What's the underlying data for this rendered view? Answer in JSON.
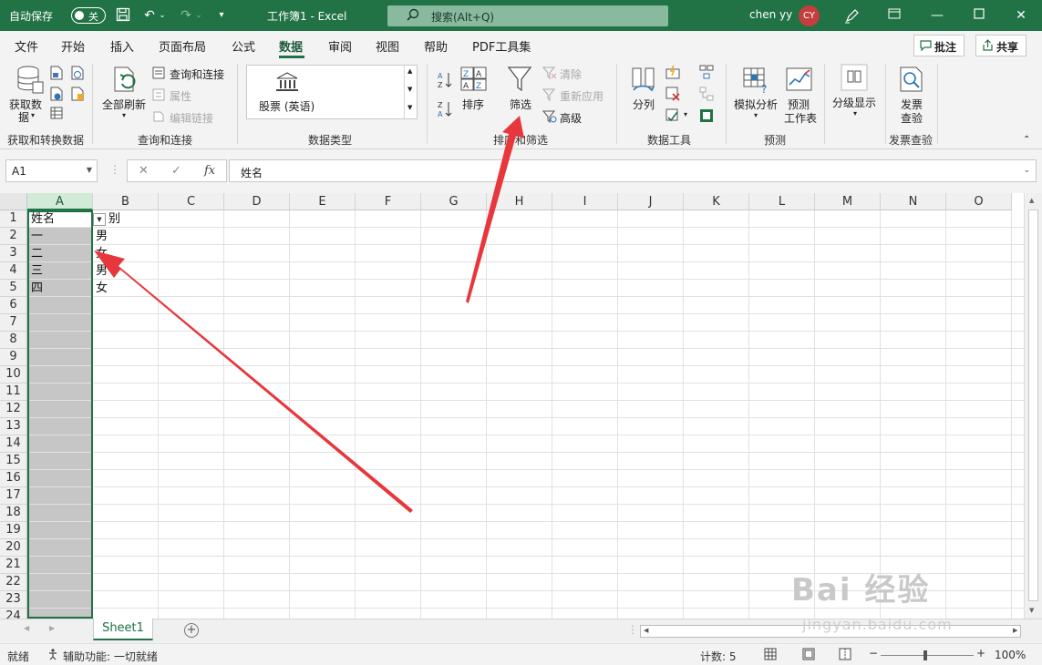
{
  "titlebar": {
    "autosave_label": "自动保存",
    "autosave_state": "关",
    "doc_title": "工作簿1  -  Excel",
    "search_placeholder": "搜索(Alt+Q)",
    "user_name": "chen yy",
    "user_initials": "CY"
  },
  "menu": {
    "tabs": [
      "文件",
      "开始",
      "插入",
      "页面布局",
      "公式",
      "数据",
      "审阅",
      "视图",
      "帮助",
      "PDF工具集"
    ],
    "active_tab": "数据",
    "comments_label": "批注",
    "share_label": "共享"
  },
  "ribbon": {
    "get_data": "获取数",
    "get_data2": "据",
    "refresh_all": "全部刷新",
    "queries_connections": "查询和连接",
    "properties": "属性",
    "edit_links": "编辑链接",
    "stocks": "股票 (英语)",
    "sort": "排序",
    "filter": "筛选",
    "clear": "清除",
    "reapply": "重新应用",
    "advanced": "高级",
    "text_to_columns": "分列",
    "what_if": "模拟分析",
    "forecast_sheet": "预测",
    "forecast_sheet2": "工作表",
    "outline": "分级显示",
    "invoice_check": "发票",
    "invoice_check2": "查验",
    "groups": {
      "get_transform": "获取和转换数据",
      "queries": "查询和连接",
      "data_types": "数据类型",
      "sort_filter": "排序和筛选",
      "data_tools": "数据工具",
      "forecast": "预测",
      "invoice": "发票查验"
    }
  },
  "formula_bar": {
    "name_box": "A1",
    "cancel": "✕",
    "enter": "✓",
    "fx": "fx",
    "content": "姓名"
  },
  "sheet": {
    "columns": [
      "A",
      "B",
      "C",
      "D",
      "E",
      "F",
      "G",
      "H",
      "I",
      "J",
      "K",
      "L",
      "M",
      "N",
      "O"
    ],
    "rows": [
      "1",
      "2",
      "3",
      "4",
      "5",
      "6",
      "7",
      "8",
      "9",
      "10",
      "11",
      "12",
      "13",
      "14",
      "15",
      "16",
      "17",
      "18",
      "19",
      "20",
      "21",
      "22",
      "23",
      "24"
    ],
    "cells": {
      "a1": "姓名",
      "b1": "别",
      "a2": "一",
      "b2": "男",
      "a3": "二",
      "b3": "女",
      "a4": "三",
      "b4": "男",
      "a5": "四",
      "b5": "女"
    }
  },
  "tabs": {
    "sheet1": "Sheet1"
  },
  "status": {
    "ready": "就绪",
    "accessibility": "辅助功能: 一切就绪",
    "count": "计数: 5",
    "zoom": "100%"
  },
  "watermark": {
    "main": "Bai 经验",
    "sub": "jingyan.baidu.com"
  },
  "colors": {
    "excel_green": "#217346",
    "annotation_red": "#e8373c"
  }
}
